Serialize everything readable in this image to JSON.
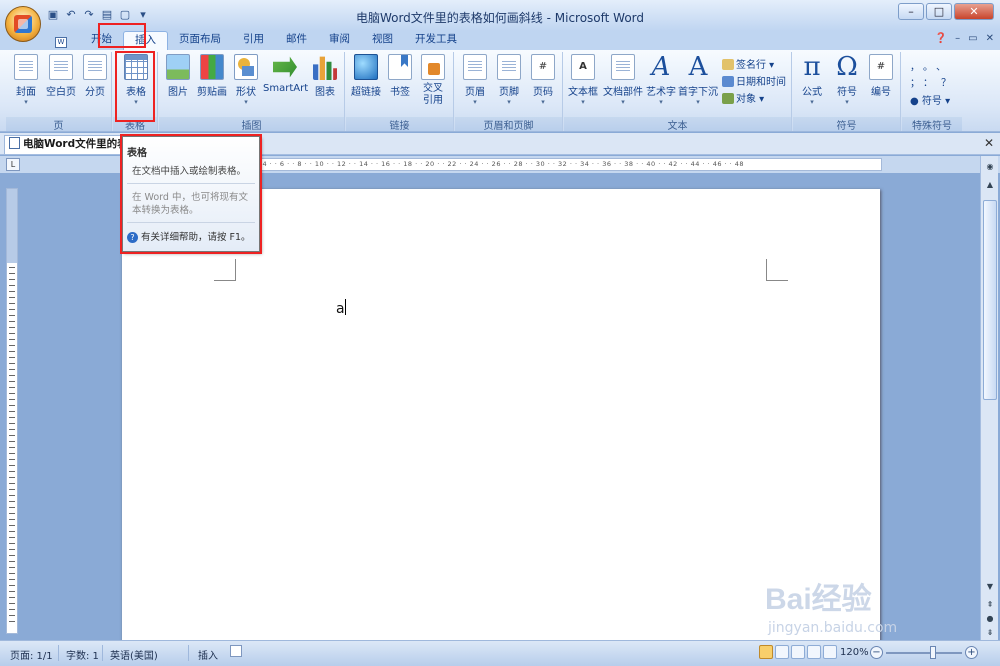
{
  "window": {
    "title": "电脑Word文件里的表格如何画斜线 - Microsoft Word",
    "controls": [
      "minimize",
      "maximize",
      "close"
    ]
  },
  "quick_access": [
    "save-icon",
    "undo-icon",
    "redo-icon",
    "new-icon",
    "print-preview-icon"
  ],
  "tabs": [
    {
      "label": "开始"
    },
    {
      "label": "插入",
      "active": true
    },
    {
      "label": "页面布局"
    },
    {
      "label": "引用"
    },
    {
      "label": "邮件"
    },
    {
      "label": "审阅"
    },
    {
      "label": "视图"
    },
    {
      "label": "开发工具"
    }
  ],
  "mdi": [
    "help-icon",
    "minimize",
    "restore",
    "close"
  ],
  "ribbon": {
    "groups": [
      {
        "label": "页",
        "buttons": [
          "封面",
          "空白页",
          "分页"
        ]
      },
      {
        "label": "表格",
        "buttons": [
          "表格"
        ]
      },
      {
        "label": "插图",
        "buttons": [
          "图片",
          "剪贴画",
          "形状",
          "SmartArt",
          "图表"
        ]
      },
      {
        "label": "链接",
        "buttons": [
          "超链接",
          "书签",
          "交叉引用"
        ]
      },
      {
        "label": "页眉和页脚",
        "buttons": [
          "页眉",
          "页脚",
          "页码"
        ]
      },
      {
        "label": "文本",
        "buttons": [
          "文本框",
          "文档部件",
          "艺术字",
          "首字下沉"
        ],
        "small": [
          "签名行",
          "日期和时间",
          "对象"
        ]
      },
      {
        "label": "符号",
        "buttons": [
          "公式",
          "符号",
          "编号"
        ]
      },
      {
        "label": "特殊符号",
        "small": [
          "符号"
        ]
      }
    ]
  },
  "doc_tab": {
    "label": "电脑Word文件里的表格如何画斜线.doc *"
  },
  "ruler": {
    "marks": "2 · · 4 · · 6 · · 8 · · 10 · · 12 · · 14 · · 16 · · 18 · · 20 · · 22 · · 24 · · 26 · · 28 · · 30 · · 32 · · 34 · · 36 · · 38 · · 40 · · 42 · · 44 · · 46 · · 48"
  },
  "document": {
    "typed_text": "a"
  },
  "tooltip": {
    "title": "表格",
    "description": "在文档中插入或绘制表格。",
    "extra": "在 Word 中，也可将现有文本转换为表格。",
    "help": "有关详细帮助，请按 F1。"
  },
  "status": {
    "page": "页面: 1/1",
    "words": "字数: 1",
    "language": "英语(美国)",
    "mode": "插入",
    "zoom": "120%"
  },
  "watermark": {
    "brand": "Bai经验",
    "url": "jingyan.baidu.com"
  },
  "colors": {
    "highlight": "#e22222",
    "ribbon_text": "#15428b"
  }
}
